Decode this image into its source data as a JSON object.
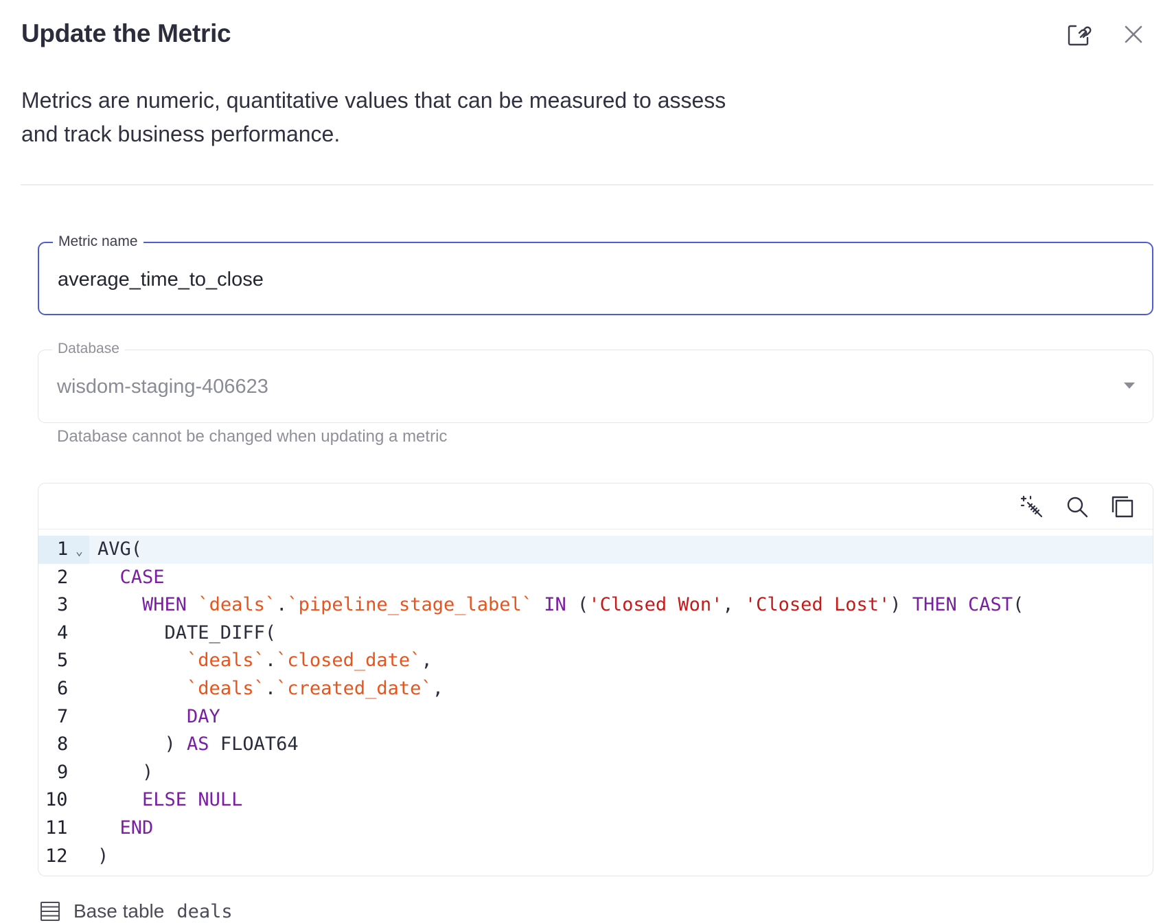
{
  "dialog": {
    "title": "Update the Metric",
    "description": "Metrics are numeric, quantitative values that can be measured to assess and track business performance.",
    "icons": {
      "link": "link-edit-icon",
      "close": "close-icon"
    }
  },
  "metric_name": {
    "label": "Metric name",
    "value": "average_time_to_close"
  },
  "database": {
    "label": "Database",
    "value": "wisdom-staging-406623",
    "helper": "Database cannot be changed when updating a metric",
    "disabled": true
  },
  "editor": {
    "toolbar": [
      "magic-wand-icon",
      "search-icon",
      "copy-icon"
    ],
    "active_line": 1,
    "lines": [
      {
        "n": "1",
        "tokens": [
          [
            "pl",
            "AVG("
          ]
        ]
      },
      {
        "n": "2",
        "tokens": [
          [
            "pl",
            "  "
          ],
          [
            "kw",
            "CASE"
          ]
        ]
      },
      {
        "n": "3",
        "tokens": [
          [
            "pl",
            "    "
          ],
          [
            "kw",
            "WHEN"
          ],
          [
            "pl",
            " "
          ],
          [
            "id",
            "`deals`"
          ],
          [
            "pl",
            "."
          ],
          [
            "id",
            "`pipeline_stage_label`"
          ],
          [
            "pl",
            " "
          ],
          [
            "kw",
            "IN"
          ],
          [
            "pl",
            " ("
          ],
          [
            "str",
            "'Closed Won'"
          ],
          [
            "pl",
            ", "
          ],
          [
            "str",
            "'Closed Lost'"
          ],
          [
            "pl",
            ") "
          ],
          [
            "kw",
            "THEN"
          ],
          [
            "pl",
            " "
          ],
          [
            "kw",
            "CAST"
          ],
          [
            "pl",
            "("
          ]
        ]
      },
      {
        "n": "4",
        "tokens": [
          [
            "pl",
            "      DATE_DIFF("
          ]
        ]
      },
      {
        "n": "5",
        "tokens": [
          [
            "pl",
            "        "
          ],
          [
            "id",
            "`deals`"
          ],
          [
            "pl",
            "."
          ],
          [
            "id",
            "`closed_date`"
          ],
          [
            "pl",
            ","
          ]
        ]
      },
      {
        "n": "6",
        "tokens": [
          [
            "pl",
            "        "
          ],
          [
            "id",
            "`deals`"
          ],
          [
            "pl",
            "."
          ],
          [
            "id",
            "`created_date`"
          ],
          [
            "pl",
            ","
          ]
        ]
      },
      {
        "n": "7",
        "tokens": [
          [
            "pl",
            "        "
          ],
          [
            "kw",
            "DAY"
          ]
        ]
      },
      {
        "n": "8",
        "tokens": [
          [
            "pl",
            "      ) "
          ],
          [
            "kw",
            "AS"
          ],
          [
            "pl",
            " FLOAT64"
          ]
        ]
      },
      {
        "n": "9",
        "tokens": [
          [
            "pl",
            "    )"
          ]
        ]
      },
      {
        "n": "10",
        "tokens": [
          [
            "pl",
            "    "
          ],
          [
            "kw",
            "ELSE"
          ],
          [
            "pl",
            " "
          ],
          [
            "kw",
            "NULL"
          ]
        ]
      },
      {
        "n": "11",
        "tokens": [
          [
            "pl",
            "  "
          ],
          [
            "kw",
            "END"
          ]
        ]
      },
      {
        "n": "12",
        "tokens": [
          [
            "pl",
            ")"
          ]
        ]
      }
    ]
  },
  "base_table": {
    "label": "Base table",
    "value": "deals",
    "icon": "table-icon"
  }
}
